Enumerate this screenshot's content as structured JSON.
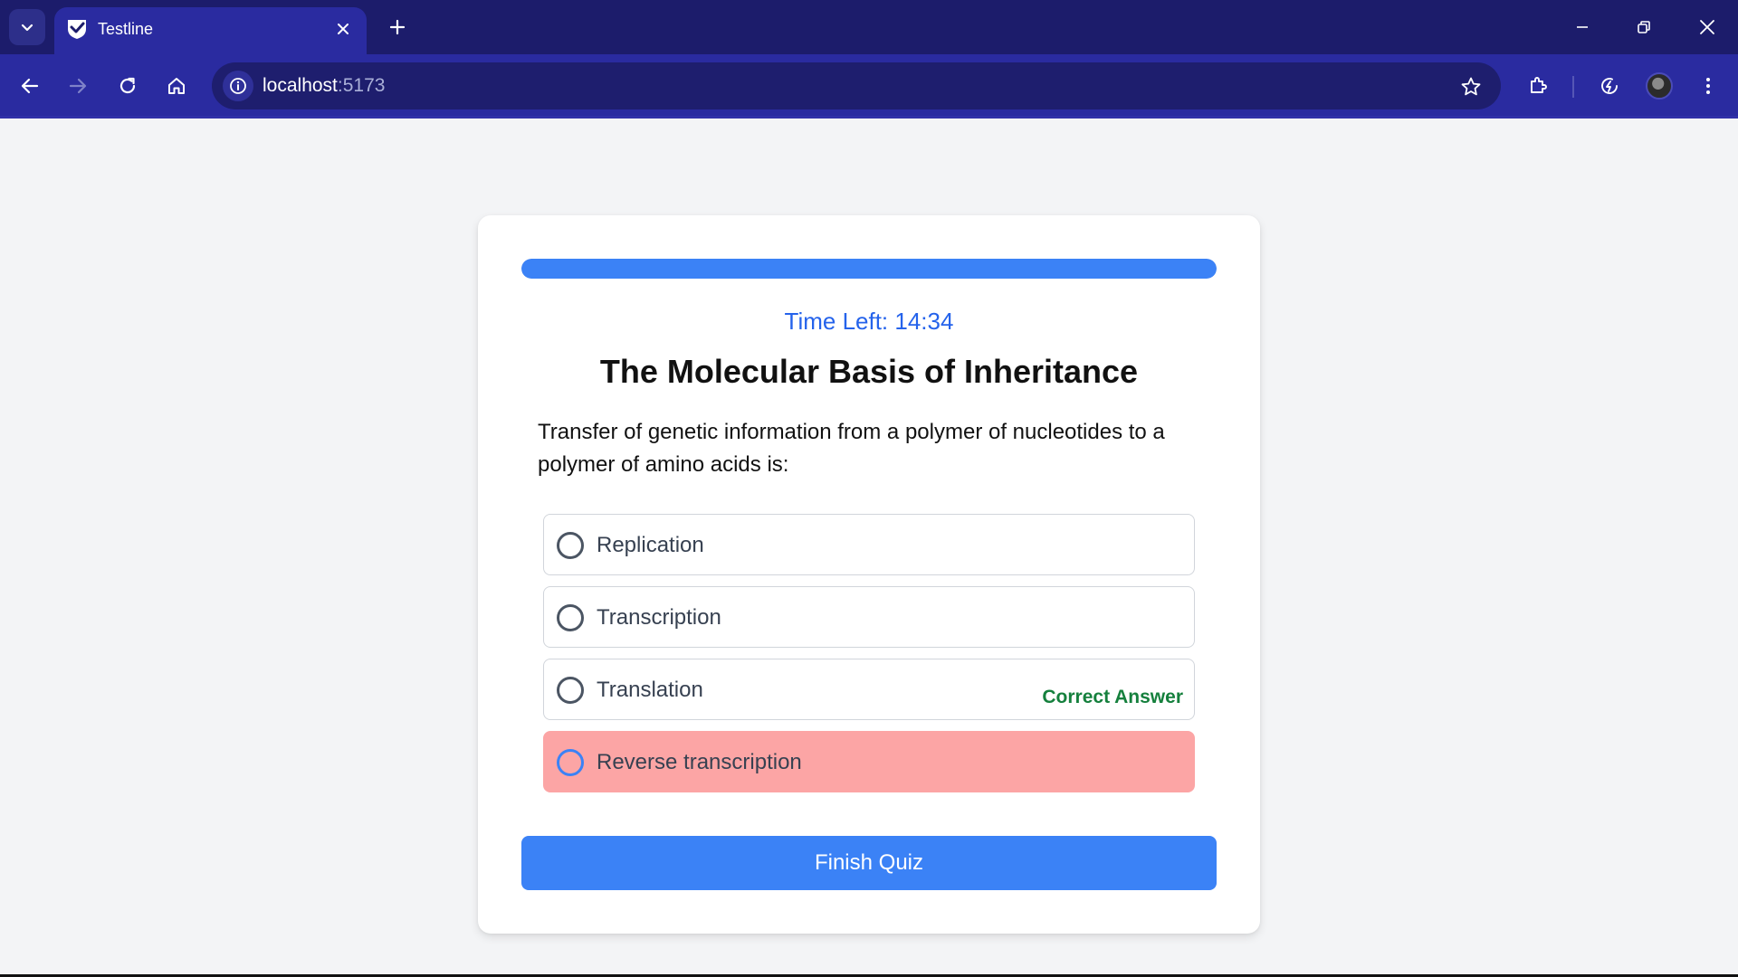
{
  "browser": {
    "tab": {
      "title": "Testline"
    },
    "address": {
      "host": "localhost",
      "port": ":5173"
    }
  },
  "quiz": {
    "progress_fraction": 1.0,
    "timer_text": "Time Left: 14:34",
    "title": "The Molecular Basis of Inheritance",
    "question": "Transfer of genetic information from a polymer of nucleotides to a polymer of amino acids is:",
    "options": [
      {
        "label": "Replication",
        "state": "default"
      },
      {
        "label": "Transcription",
        "state": "default"
      },
      {
        "label": "Translation",
        "state": "correct",
        "tag": "Correct Answer"
      },
      {
        "label": "Reverse transcription",
        "state": "wrong"
      }
    ],
    "finish_label": "Finish Quiz"
  },
  "colors": {
    "accent": "#3b82f6",
    "timer": "#2563eb",
    "wrong_bg": "#fca5a5",
    "correct_text": "#15803d",
    "tabbar_bg": "#1c1c6b",
    "toolbar_bg": "#2a2ba0"
  }
}
